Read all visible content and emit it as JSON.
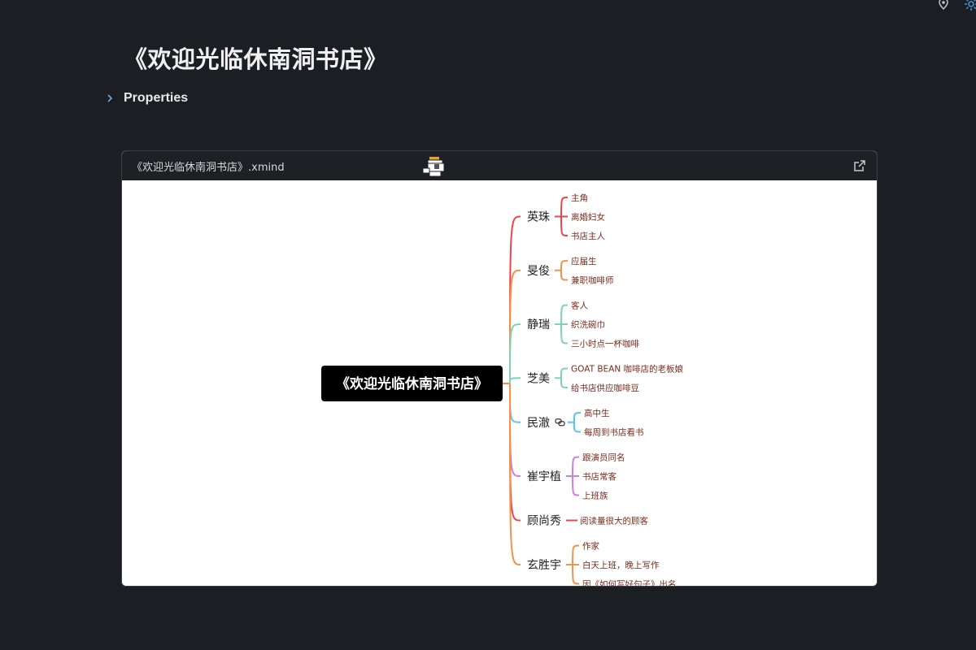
{
  "page": {
    "title": "《欢迎光临休南洞书店》",
    "properties_label": "Properties"
  },
  "embed": {
    "file_name": "《欢迎光临休南洞书店》.xmind",
    "open_icon": "external-link-icon",
    "mascot_icon": "pixel-bird-icon"
  },
  "mindmap": {
    "root": "《欢迎光临休南洞书店》",
    "colors": {
      "root_bg": "#000000",
      "root_text": "#ffffff",
      "trunk": "#f08a3c"
    },
    "branches": [
      {
        "label": "英珠",
        "color": "#e8464a",
        "children": [
          "主角",
          "离婚妇女",
          "书店主人"
        ]
      },
      {
        "label": "旻俊",
        "color": "#f3924a",
        "children": [
          "应届生",
          "兼职咖啡师"
        ]
      },
      {
        "label": "静瑞",
        "color": "#7ed3b2",
        "children": [
          "客人",
          "织洗碗巾",
          "三小时点一杯咖啡"
        ]
      },
      {
        "label": "芝美",
        "color": "#7ed3b2",
        "children": [
          "GOAT BEAN 咖啡店的老板娘",
          "给书店供应咖啡豆"
        ]
      },
      {
        "label": "民澈",
        "color": "#5bc5e8",
        "has_link": true,
        "children": [
          "高中生",
          "每周到书店看书"
        ]
      },
      {
        "label": "崔宇植",
        "color": "#cf7ee0",
        "children": [
          "跟演员同名",
          "书店常客",
          "上班族"
        ]
      },
      {
        "label": "顾尚秀",
        "color": "#e8464a",
        "children": [
          "阅读量很大的顾客"
        ]
      },
      {
        "label": "玄胜宇",
        "color": "#f3924a",
        "children": [
          "作家",
          "白天上班，晚上写作",
          "因《如何写好句子》出名"
        ]
      }
    ]
  }
}
